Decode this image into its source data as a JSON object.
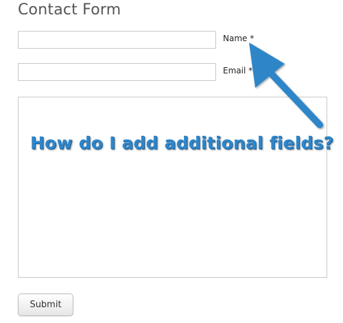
{
  "form": {
    "title": "Contact Form",
    "name_label": "Name *",
    "name_value": "",
    "email_label": "Email *",
    "email_value": "",
    "message_value": "",
    "submit_label": "Submit"
  },
  "annotation": {
    "text": "How do I add additional fields?",
    "color": "#2f86c9",
    "arrow_icon": "arrow-up-left-icon"
  }
}
